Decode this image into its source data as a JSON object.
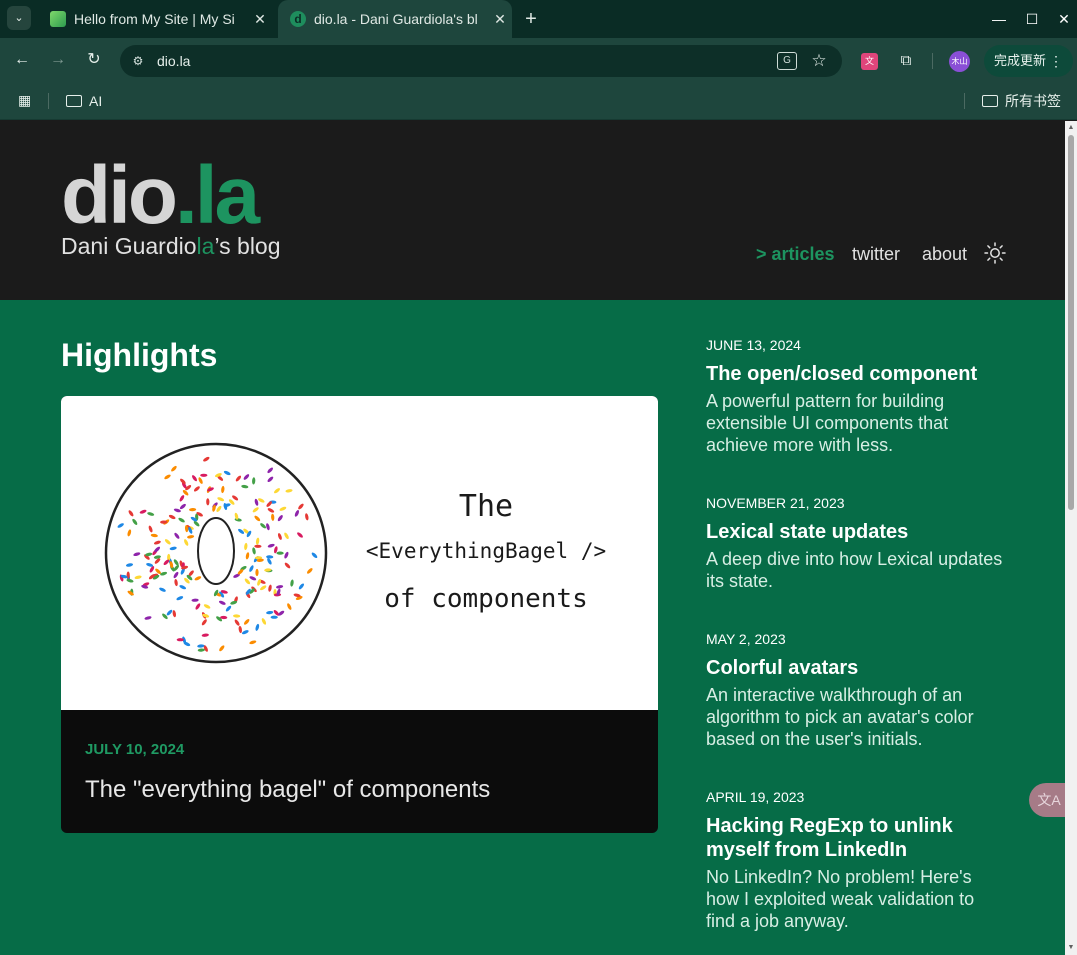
{
  "browser": {
    "tabs": [
      {
        "title": "Hello from My Site | My Si"
      },
      {
        "title": "dio.la - Dani Guardiola's bl"
      }
    ],
    "tab2_favicon_letter": "d",
    "url": "dio.la",
    "update_button": "完成更新",
    "profile_initials": "木山",
    "bookmarks": {
      "folder_ai": "AI",
      "all_bookmarks": "所有书签"
    }
  },
  "site": {
    "logo_part1": "dio",
    "logo_dot": ".",
    "logo_part2": "la",
    "tagline_prefix": "Dani Guardio",
    "tagline_highlight": "la",
    "tagline_suffix": "’s blog",
    "nav": {
      "articles": "> articles",
      "twitter": "twitter",
      "about": "about"
    },
    "highlights_title": "Highlights",
    "featured": {
      "image_line1": "The",
      "image_line2": "<EverythingBagel />",
      "image_line3": "of components",
      "date": "JULY 10, 2024",
      "title": "The \"everything bagel\" of components"
    },
    "posts": [
      {
        "date": "JUNE 13, 2024",
        "title": "The open/closed component",
        "description": "A powerful pattern for building extensible UI components that achieve more with less."
      },
      {
        "date": "NOVEMBER 21, 2023",
        "title": "Lexical state updates",
        "description": "A deep dive into how Lexical updates its state."
      },
      {
        "date": "MAY 2, 2023",
        "title": "Colorful avatars",
        "description": "An interactive walkthrough of an algorithm to pick an avatar's color based on the user's initials."
      },
      {
        "date": "APRIL 19, 2023",
        "title": "Hacking RegExp to unlink myself from LinkedIn",
        "description": "No LinkedIn? No problem! Here's how I exploited weak validation to find a job anyway."
      }
    ]
  },
  "colors": {
    "brand_green": "#1d9460",
    "page_green": "#066c47",
    "header_dark": "#1b1b1b",
    "chrome_dark": "#0a2c25",
    "chrome_toolbar": "#1e463d"
  }
}
